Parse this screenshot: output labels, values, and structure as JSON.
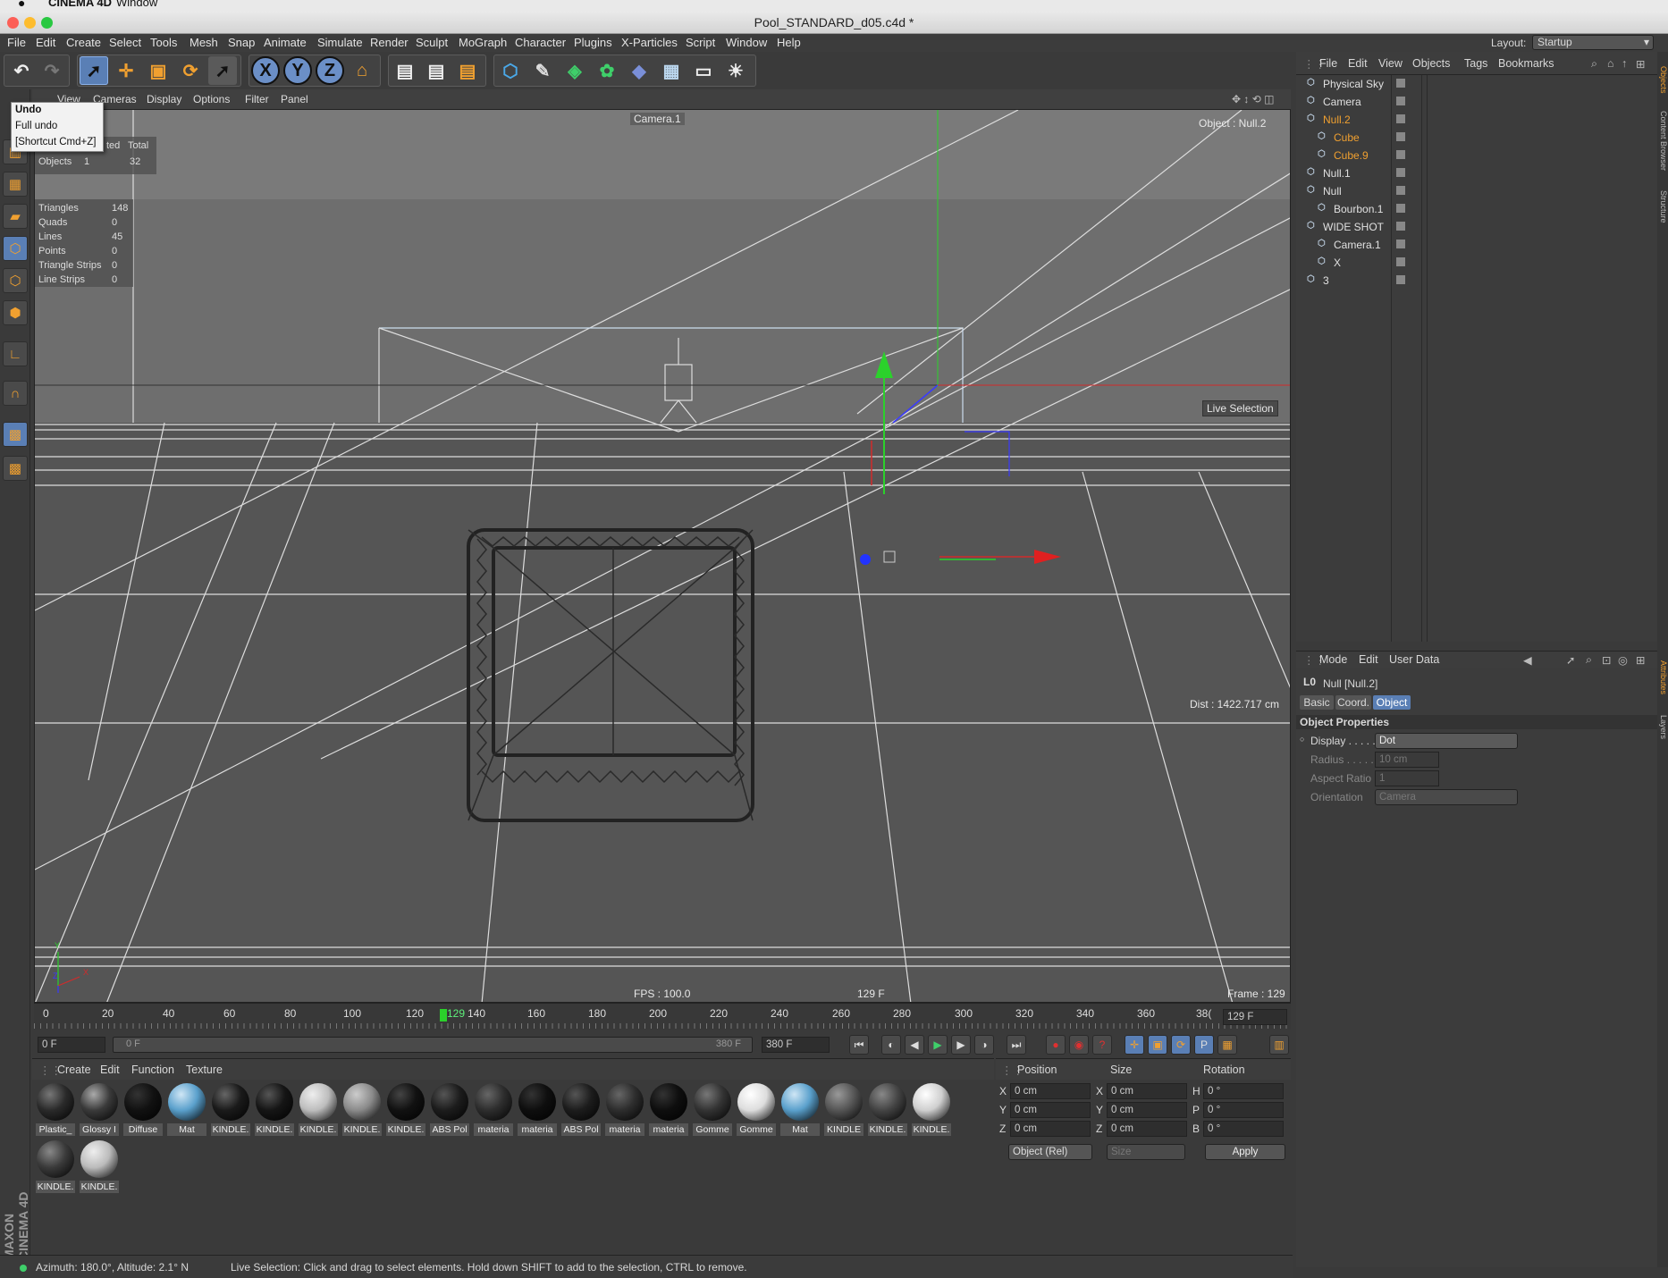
{
  "mac_menu": {
    "app": "CINEMA 4D",
    "window": "Window"
  },
  "window": {
    "title": "Pool_STANDARD_d05.c4d *"
  },
  "menu": [
    "File",
    "Edit",
    "Create",
    "Select",
    "Tools",
    "Mesh",
    "Snap",
    "Animate",
    "Simulate",
    "Render",
    "Sculpt",
    "MoGraph",
    "Character",
    "Plugins",
    "X-Particles",
    "Script",
    "Window",
    "Help"
  ],
  "layout": {
    "label": "Layout:",
    "value": "Startup"
  },
  "toolbar": {
    "x_label": "X",
    "y_label": "Y",
    "z_label": "Z"
  },
  "undo_tooltip": {
    "title": "Undo",
    "item": "Full undo",
    "shortcut": "[Shortcut Cmd+Z]"
  },
  "viewport_menu": [
    "View",
    "Cameras",
    "Display",
    "Options",
    "Filter",
    "Panel"
  ],
  "viewport": {
    "camera_label": "Camera.1",
    "object_label": "Object : Null.2",
    "live_selection": "Live Selection",
    "distance": "Dist : 1422.717 cm",
    "fps": "FPS : 100.0",
    "frame_center": "129 F",
    "frame": "Frame : 129",
    "axis_y": "Y",
    "axis_x": "X",
    "axis_z": "Z",
    "stats_header": {
      "selected": "ted",
      "total": "Total"
    },
    "stats_objects": {
      "label": "Objects",
      "selected": "1",
      "total": "32"
    },
    "stats": [
      {
        "label": "Triangles",
        "value": "148"
      },
      {
        "label": "Quads",
        "value": "0"
      },
      {
        "label": "Lines",
        "value": "45"
      },
      {
        "label": "Points",
        "value": "0"
      },
      {
        "label": "Triangle Strips",
        "value": "0"
      },
      {
        "label": "Line Strips",
        "value": "0"
      }
    ]
  },
  "timeline": {
    "ticks": [
      "0",
      "20",
      "40",
      "60",
      "80",
      "100",
      "120",
      "140",
      "160",
      "180",
      "200",
      "220",
      "240",
      "260",
      "280",
      "300",
      "320",
      "340",
      "360",
      "38("
    ],
    "current": "129",
    "current_field": "129 F"
  },
  "playbar": {
    "start": "0 F",
    "range_start": "0 F",
    "range_end": "380 F",
    "end": "380 F"
  },
  "material_menu": [
    "Create",
    "Edit",
    "Function",
    "Texture"
  ],
  "materials": [
    {
      "name": "Plastic_",
      "color": "#2a2a2a",
      "hl": "#777"
    },
    {
      "name": "Glossy I",
      "color": "#3a3a3a",
      "hl": "#aaa"
    },
    {
      "name": "Diffuse",
      "color": "#111111",
      "hl": "#333"
    },
    {
      "name": "Mat",
      "color": "#5aa0cc",
      "hl": "#cfe6f5"
    },
    {
      "name": "KINDLE.",
      "color": "#1a1a1a",
      "hl": "#666"
    },
    {
      "name": "KINDLE.",
      "color": "#151515",
      "hl": "#555"
    },
    {
      "name": "KINDLE.",
      "color": "#bdbdbd",
      "hl": "#eee"
    },
    {
      "name": "KINDLE.",
      "color": "#8a8a8a",
      "hl": "#ccc"
    },
    {
      "name": "KINDLE.",
      "color": "#111111",
      "hl": "#444"
    },
    {
      "name": "ABS Pol",
      "color": "#1c1c1c",
      "hl": "#555"
    },
    {
      "name": "materia",
      "color": "#2d2d2d",
      "hl": "#666"
    },
    {
      "name": "materia",
      "color": "#0e0e0e",
      "hl": "#333"
    },
    {
      "name": "ABS Pol",
      "color": "#1c1c1c",
      "hl": "#555"
    },
    {
      "name": "materia",
      "color": "#2d2d2d",
      "hl": "#666"
    },
    {
      "name": "materia",
      "color": "#0e0e0e",
      "hl": "#333"
    },
    {
      "name": "Gomme",
      "color": "#333333",
      "hl": "#777"
    },
    {
      "name": "Gomme",
      "color": "#dddddd",
      "hl": "#fff"
    },
    {
      "name": "Mat",
      "color": "#5aa0cc",
      "hl": "#cfe6f5"
    },
    {
      "name": "KINDLE",
      "color": "#555555",
      "hl": "#999"
    },
    {
      "name": "KINDLE.",
      "color": "#444444",
      "hl": "#888"
    },
    {
      "name": "KINDLE.",
      "color": "#cfcfcf",
      "hl": "#fff"
    },
    {
      "name": "KINDLE.",
      "color": "#3a3a3a",
      "hl": "#888"
    },
    {
      "name": "KINDLE.",
      "color": "#bbbbbb",
      "hl": "#eee"
    }
  ],
  "coords": {
    "headers": {
      "position": "Position",
      "size": "Size",
      "rotation": "Rotation"
    },
    "rows": [
      {
        "axis": "X",
        "pos": "0 cm",
        "saxis": "X",
        "size": "0 cm",
        "raxis": "H",
        "rot": "0 °"
      },
      {
        "axis": "Y",
        "pos": "0 cm",
        "saxis": "Y",
        "size": "0 cm",
        "raxis": "P",
        "rot": "0 °"
      },
      {
        "axis": "Z",
        "pos": "0 cm",
        "saxis": "Z",
        "size": "0 cm",
        "raxis": "B",
        "rot": "0 °"
      }
    ],
    "mode": "Object (Rel)",
    "size_mode": "Size",
    "apply": "Apply"
  },
  "objects_menu": [
    "File",
    "Edit",
    "View",
    "Objects",
    "Tags",
    "Bookmarks"
  ],
  "objects": [
    {
      "name": "Physical Sky",
      "color": "#e0e0e0",
      "indent": 0
    },
    {
      "name": "Camera",
      "color": "#e0e0e0",
      "indent": 0
    },
    {
      "name": "Null.2",
      "color": "#f0a030",
      "indent": 0
    },
    {
      "name": "Cube",
      "color": "#f0a030",
      "indent": 1
    },
    {
      "name": "Cube.9",
      "color": "#f0a030",
      "indent": 1
    },
    {
      "name": "Null.1",
      "color": "#e0e0e0",
      "indent": 0
    },
    {
      "name": "Null",
      "color": "#e0e0e0",
      "indent": 0
    },
    {
      "name": "Bourbon.1",
      "color": "#e0e0e0",
      "indent": 1
    },
    {
      "name": "WIDE SHOT",
      "color": "#e0e0e0",
      "indent": 0
    },
    {
      "name": "Camera.1",
      "color": "#e0e0e0",
      "indent": 1
    },
    {
      "name": "X",
      "color": "#e0e0e0",
      "indent": 1
    },
    {
      "name": "3",
      "color": "#e0e0e0",
      "indent": 0
    }
  ],
  "attr_menu": [
    "Mode",
    "Edit",
    "User Data"
  ],
  "attributes": {
    "object_name": "Null [Null.2]",
    "tabs": [
      "Basic",
      "Coord.",
      "Object"
    ],
    "section": "Object Properties",
    "props": [
      {
        "label": "Display . . . . .",
        "value": "Dot",
        "enabled": true
      },
      {
        "label": "Radius . . . . . .",
        "value": "10 cm",
        "enabled": false
      },
      {
        "label": "Aspect Ratio",
        "value": "1",
        "enabled": false
      },
      {
        "label": "Orientation",
        "value": "Camera",
        "enabled": false
      }
    ]
  },
  "side_tabs": [
    "Objects",
    "Content Browser",
    "Structure",
    "Attributes",
    "Layers"
  ],
  "status": {
    "azimuth": "Azimuth: 180.0°, Altitude: 2.1°  N",
    "message": "Live Selection: Click and drag to select elements. Hold down SHIFT to add to the selection, CTRL to remove."
  },
  "maxon": "MAXON CINEMA 4D"
}
